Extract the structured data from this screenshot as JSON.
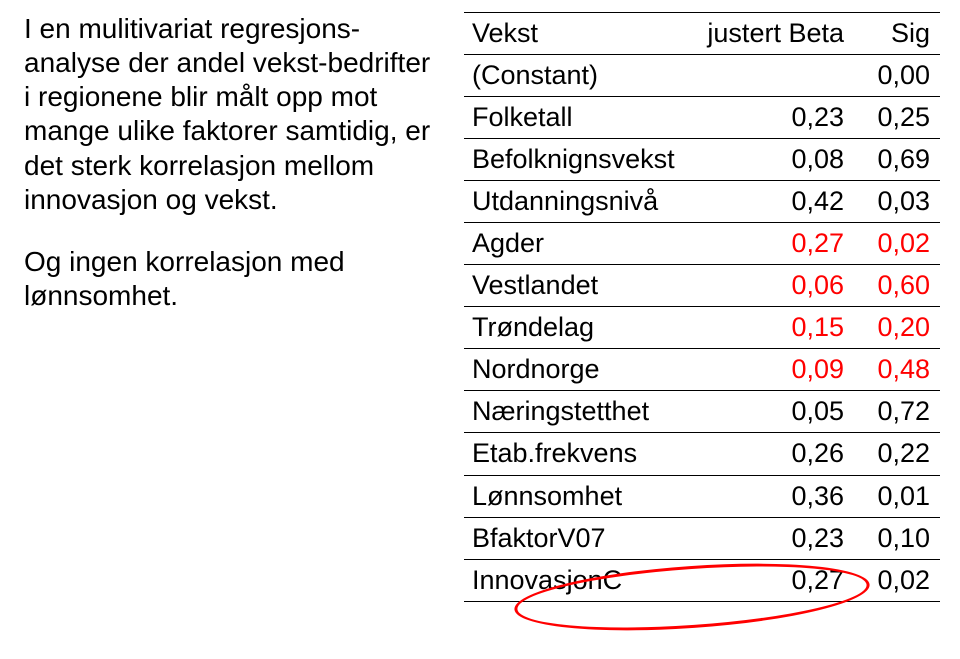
{
  "left": {
    "para1": "I en mulitivariat regresjons-analyse der andel vekst-bedrifter i regionene blir målt opp mot mange ulike faktorer samtidig, er det sterk korrelasjon mellom innovasjon og vekst.",
    "para2": "Og ingen korrelasjon med lønnsomhet."
  },
  "table": {
    "head": {
      "c1": "Vekst",
      "c2": "justert Beta",
      "c3": "Sig"
    },
    "rows": [
      {
        "c1": "(Constant)",
        "c2": "",
        "c3": "0,00",
        "red": false
      },
      {
        "c1": "Folketall",
        "c2": "0,23",
        "c3": "0,25",
        "red": false
      },
      {
        "c1": "Befolknignsvekst",
        "c2": "0,08",
        "c3": "0,69",
        "red": false
      },
      {
        "c1": "Utdanningsnivå",
        "c2": "0,42",
        "c3": "0,03",
        "red": false
      },
      {
        "c1": "Agder",
        "c2": "0,27",
        "c3": "0,02",
        "red": true
      },
      {
        "c1": "Vestlandet",
        "c2": "0,06",
        "c3": "0,60",
        "red": true
      },
      {
        "c1": "Trøndelag",
        "c2": "0,15",
        "c3": "0,20",
        "red": true
      },
      {
        "c1": "Nordnorge",
        "c2": "0,09",
        "c3": "0,48",
        "red": true
      },
      {
        "c1": "Næringstetthet",
        "c2": "0,05",
        "c3": "0,72",
        "red": false
      },
      {
        "c1": "Etab.frekvens",
        "c2": "0,26",
        "c3": "0,22",
        "red": false
      },
      {
        "c1": "Lønnsomhet",
        "c2": "0,36",
        "c3": "0,01",
        "red": false
      },
      {
        "c1": "BfaktorV07",
        "c2": "0,23",
        "c3": "0,10",
        "red": false
      },
      {
        "c1": "InnovasjonC",
        "c2": "0,27",
        "c3": "0,02",
        "red": false
      }
    ]
  }
}
